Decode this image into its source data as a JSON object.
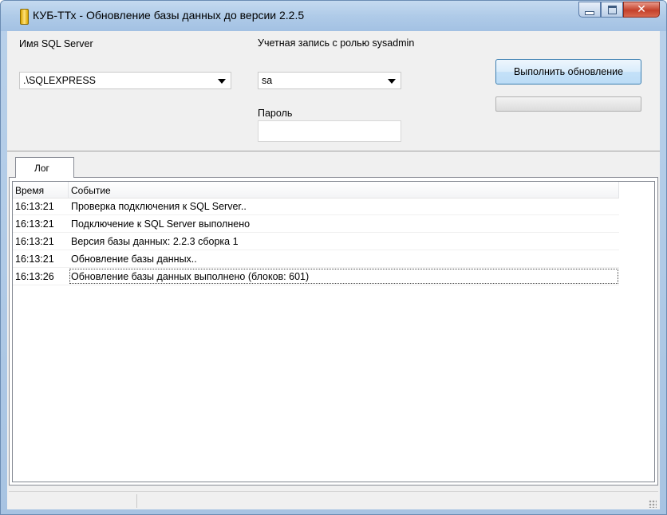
{
  "window": {
    "title": "КУБ-ТТх - Обновление базы данных до версии 2.2.5",
    "icon": "database-icon"
  },
  "form": {
    "server_label": "Имя SQL Server",
    "server_value": ".\\SQLEXPRESS",
    "account_label": "Учетная запись с ролью sysadmin",
    "account_value": "sa",
    "password_label": "Пароль",
    "password_value": "",
    "update_button": "Выполнить обновление",
    "progress_fraction": 0
  },
  "tabs": [
    {
      "label": "Лог",
      "selected": true
    }
  ],
  "log": {
    "columns": [
      "Время",
      "Событие"
    ],
    "rows": [
      {
        "time": "16:13:21",
        "event": "Проверка подключения к SQL Server.."
      },
      {
        "time": "16:13:21",
        "event": "Подключение к SQL Server выполнено"
      },
      {
        "time": "16:13:21",
        "event": "Версия базы данных: 2.2.3 сборка 1"
      },
      {
        "time": "16:13:21",
        "event": "Обновление базы данных.."
      },
      {
        "time": "16:13:26",
        "event": "Обновление базы данных выполнено (блоков: 601)"
      }
    ]
  }
}
